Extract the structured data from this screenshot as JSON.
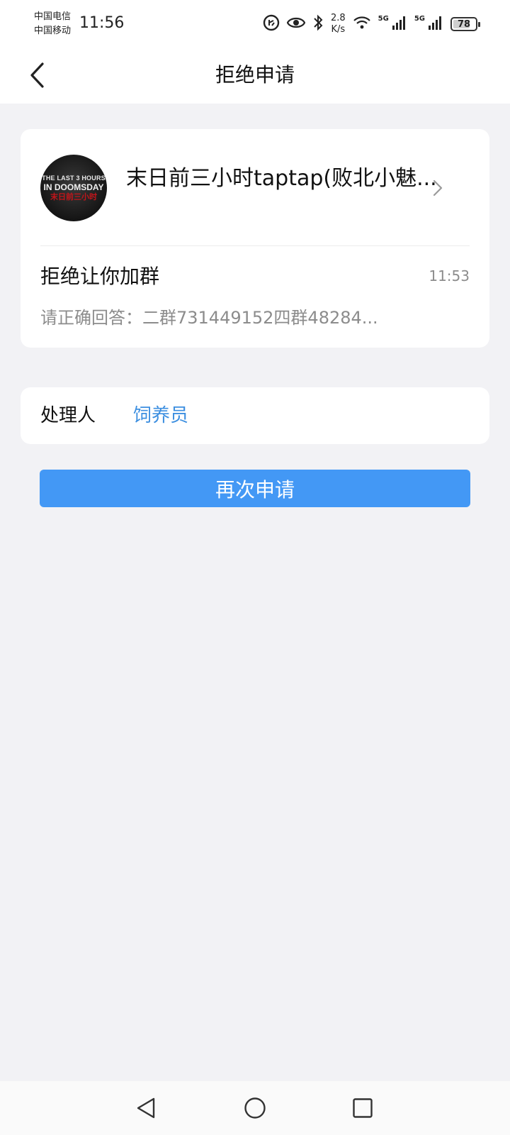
{
  "status_bar": {
    "carrier_1": "中国电信",
    "carrier_2": "中国移动",
    "time": "11:56",
    "net_speed_value": "2.8",
    "net_speed_unit": "K/s",
    "signal_1_label": "5G",
    "signal_2_label": "5G",
    "battery_level": "78",
    "icons": [
      "data-saver-icon",
      "eye-icon",
      "bluetooth-icon",
      "wifi-icon",
      "signal-icon",
      "signal-icon",
      "battery-icon"
    ]
  },
  "header": {
    "title": "拒绝申请",
    "back_icon": "chevron-left-icon"
  },
  "group": {
    "name": "末日前三小时taptap(败北小魅...",
    "avatar_text_1": "THE LAST 3 HOURS",
    "avatar_text_2": "IN DOOMSDAY",
    "avatar_text_3": "末日前三小时"
  },
  "rejection": {
    "title": "拒绝让你加群",
    "time": "11:53",
    "reason": "请正确回答：二群731449152四群48284..."
  },
  "handler": {
    "label": "处理人",
    "name": "饲养员"
  },
  "actions": {
    "reapply_label": "再次申请"
  },
  "nav_bar": {
    "icons": [
      "nav-back-icon",
      "nav-home-icon",
      "nav-recent-icon"
    ]
  },
  "colors": {
    "background": "#f2f2f5",
    "accent": "#4398f5",
    "link": "#3d8fe0",
    "secondary_text": "#8c8c8c"
  }
}
